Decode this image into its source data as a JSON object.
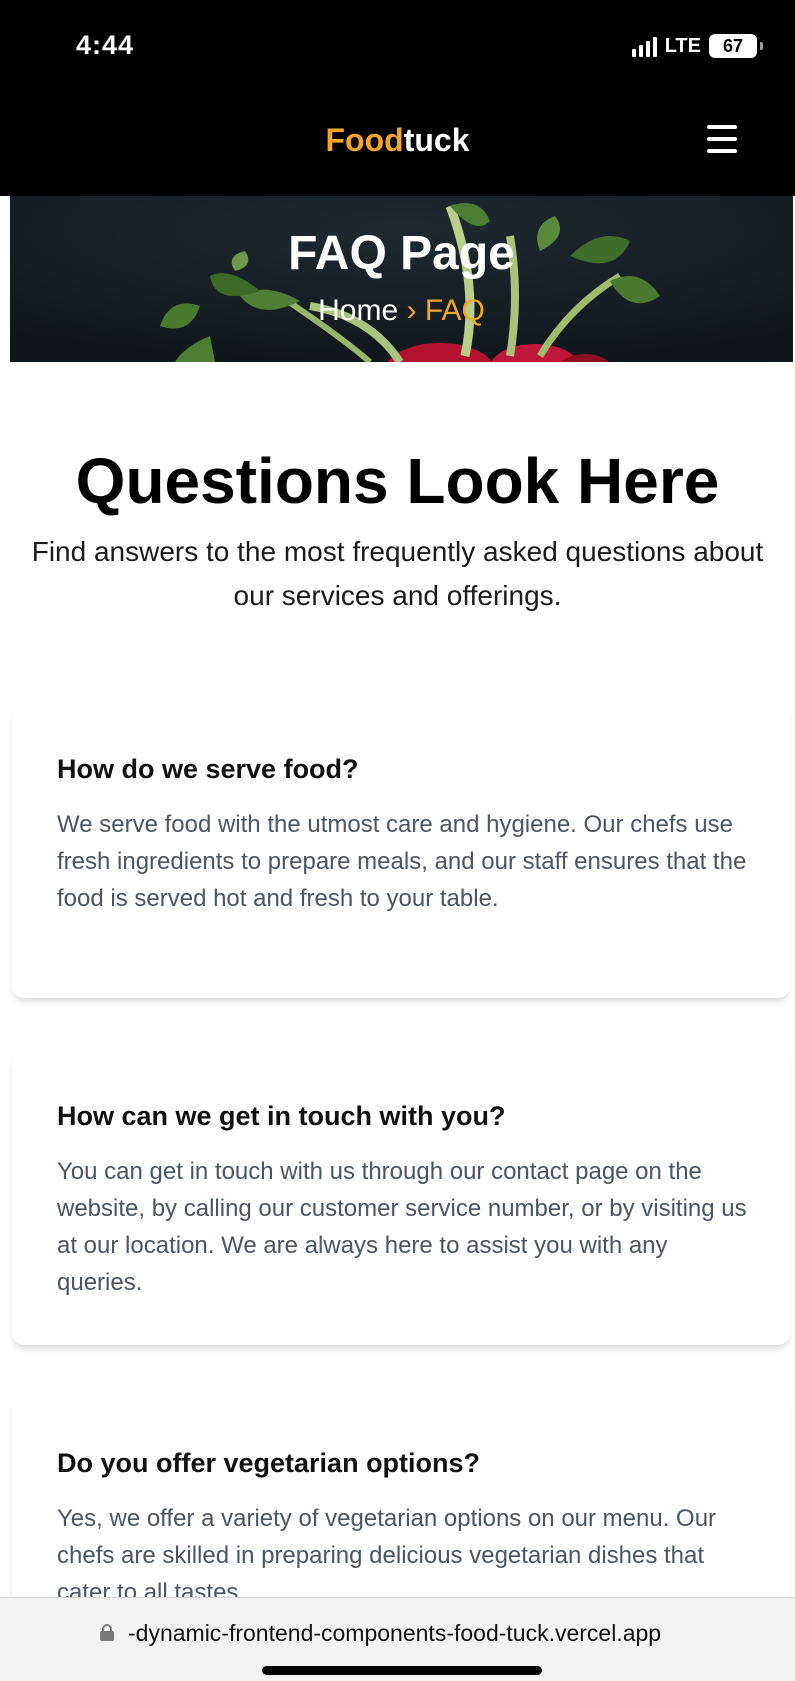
{
  "status_bar": {
    "time": "4:44",
    "network": "LTE",
    "battery": "67",
    "icons": [
      "signal-icon",
      "battery-icon"
    ]
  },
  "header": {
    "logo_accent": "Food",
    "logo_rest": "tuck",
    "menu_icon": "hamburger-menu-icon",
    "colors": {
      "accent": "#f5a524",
      "background": "#000000"
    }
  },
  "hero": {
    "title": "FAQ Page",
    "breadcrumb": {
      "home": "Home",
      "separator": "›",
      "current": "FAQ"
    }
  },
  "intro": {
    "title": "Questions Look Here",
    "subtitle": "Find answers to the most frequently asked questions about our services and offerings."
  },
  "faqs": [
    {
      "question": "How do we serve food?",
      "answer": "We serve food with the utmost care and hygiene. Our chefs use fresh ingredients to prepare meals, and our staff ensures that the food is served hot and fresh to your table."
    },
    {
      "question": "How can we get in touch with you?",
      "answer": "You can get in touch with us through our contact page on the website, by calling our customer service number, or by visiting us at our location. We are always here to assist you with any queries."
    },
    {
      "question": "Do you offer vegetarian options?",
      "answer": "Yes, we offer a variety of vegetarian options on our menu. Our chefs are skilled in preparing delicious vegetarian dishes that cater to all tastes."
    }
  ],
  "browser": {
    "url": "-dynamic-frontend-components-food-tuck.vercel.app",
    "lock_icon": "lock-icon"
  }
}
